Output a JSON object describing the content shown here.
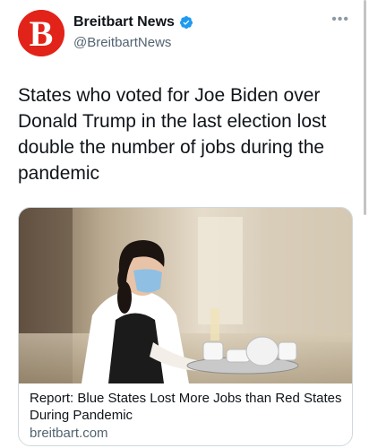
{
  "author": {
    "display_name": "Breitbart News",
    "handle": "@BreitbartNews",
    "avatar_letter": "B",
    "avatar_color": "#e2231a",
    "verified": true,
    "verified_color": "#1d9bf0"
  },
  "tweet": {
    "text": "States who voted for Joe Biden over Donald Trump in the last election lost double the number of jobs during the pandemic"
  },
  "card": {
    "title": "Report: Blue States Lost More Jobs than Red States During Pandemic",
    "domain": "breitbart.com",
    "image_description_icon": "waitress-photo"
  },
  "menu_icon": "more-icon"
}
